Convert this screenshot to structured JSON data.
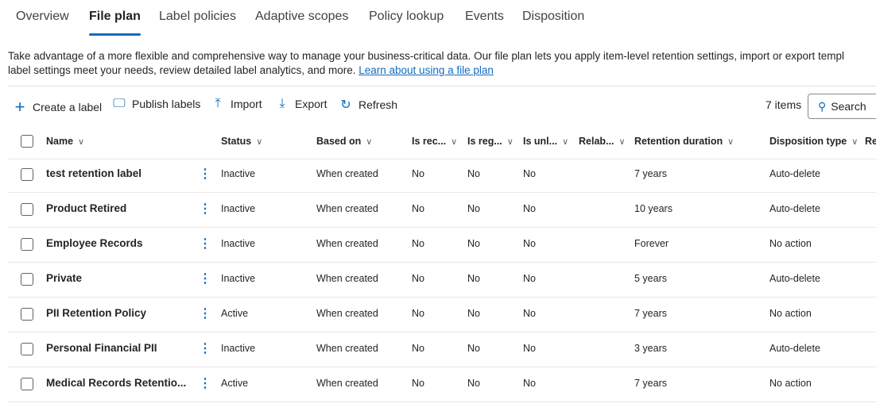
{
  "tabs": [
    "Overview",
    "File plan",
    "Label policies",
    "Adaptive scopes",
    "Policy lookup",
    "Events",
    "Disposition"
  ],
  "active_tab": "File plan",
  "description": {
    "text": "Take advantage of a more flexible and comprehensive way to manage your business-critical data. Our file plan lets you apply item-level retention settings, import or export templ",
    "text2": "label settings meet your needs, review detailed label analytics, and more. ",
    "link": "Learn about using a file plan"
  },
  "toolbar": {
    "create": "Create a label",
    "publish": "Publish labels",
    "import": "Import",
    "export": "Export",
    "refresh": "Refresh",
    "count": "7 items",
    "search": "Search"
  },
  "columns": [
    "Name",
    "Status",
    "Based on",
    "Is rec...",
    "Is reg...",
    "Is unl...",
    "Relab...",
    "Retention duration",
    "Disposition type",
    "Re"
  ],
  "rows": [
    [
      "test retention label",
      "Inactive",
      "When created",
      "No",
      "No",
      "No",
      "7 years",
      "Auto-delete"
    ],
    [
      "Product Retired",
      "Inactive",
      "When created",
      "No",
      "No",
      "No",
      "10 years",
      "Auto-delete"
    ],
    [
      "Employee Records",
      "Inactive",
      "When created",
      "No",
      "No",
      "No",
      "Forever",
      "No action"
    ],
    [
      "Private",
      "Inactive",
      "When created",
      "No",
      "No",
      "No",
      "5 years",
      "Auto-delete"
    ],
    [
      "PII Retention Policy",
      "Active",
      "When created",
      "No",
      "No",
      "No",
      "7 years",
      "No action"
    ],
    [
      "Personal Financial PII",
      "Inactive",
      "When created",
      "No",
      "No",
      "No",
      "3 years",
      "Auto-delete"
    ],
    [
      "Medical Records Retentio...",
      "Active",
      "When created",
      "No",
      "No",
      "No",
      "7 years",
      "No action"
    ]
  ]
}
